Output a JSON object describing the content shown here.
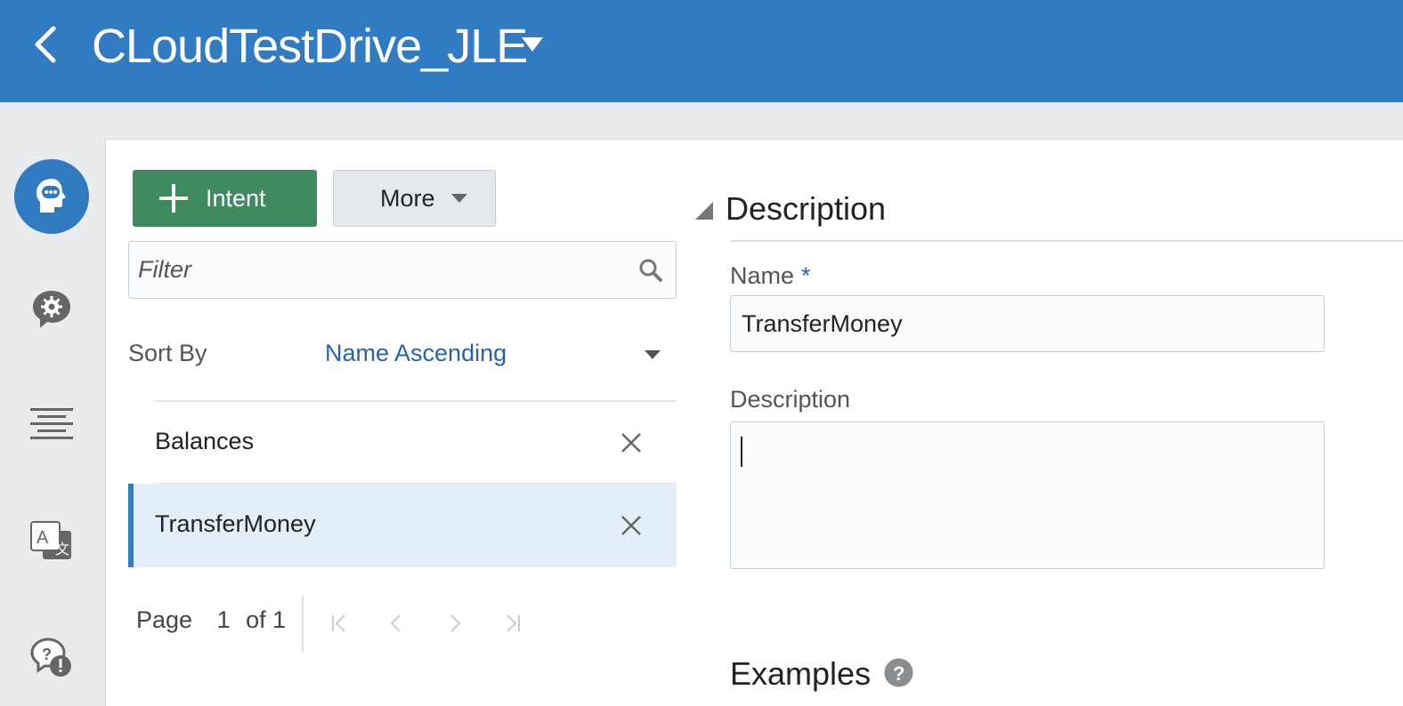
{
  "header": {
    "title": "CLoudTestDrive_JLE",
    "back_icon": "chevron-left-icon",
    "title_menu_icon": "caret-down-icon"
  },
  "rail": {
    "items": [
      {
        "name": "intents",
        "icon": "head-chat-icon",
        "active": true
      },
      {
        "name": "entities",
        "icon": "chat-gear-icon",
        "active": false
      },
      {
        "name": "flows",
        "icon": "lines-icon",
        "active": false
      },
      {
        "name": "resource-bundles",
        "icon": "translate-icon",
        "active": false
      },
      {
        "name": "qna",
        "icon": "help-chat-icon",
        "active": false
      }
    ]
  },
  "toolbar": {
    "add_label": "Intent",
    "more_label": "More"
  },
  "filter": {
    "placeholder": "Filter"
  },
  "sort": {
    "label": "Sort By",
    "value": "Name Ascending"
  },
  "intents": [
    {
      "name": "Balances",
      "selected": false
    },
    {
      "name": "TransferMoney",
      "selected": true
    }
  ],
  "pager": {
    "page_label": "Page",
    "current": "1",
    "of_label": "of 1"
  },
  "detail": {
    "section_title": "Description",
    "name_label": "Name",
    "required_mark": "*",
    "name_value": "TransferMoney",
    "description_label": "Description",
    "description_value": "",
    "examples_title": "Examples"
  },
  "colors": {
    "header": "#307bc1",
    "primary_button": "#3f8a5f",
    "link": "#2a62a9",
    "selected_row": "#e4eef8"
  }
}
